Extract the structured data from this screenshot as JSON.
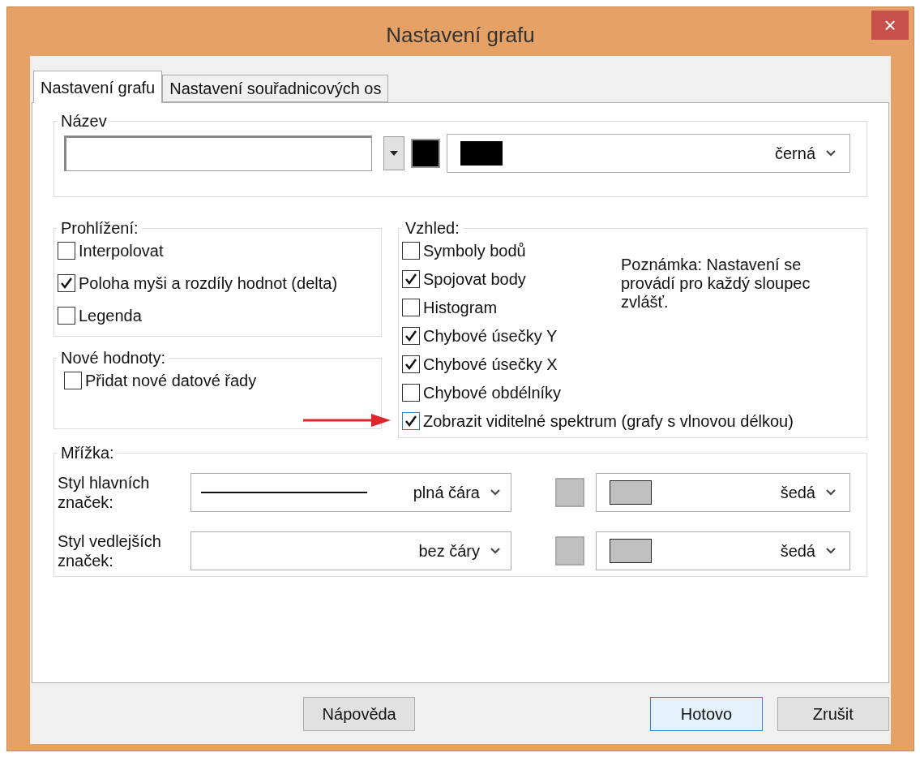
{
  "window": {
    "title": "Nastavení grafu",
    "close": "×"
  },
  "tabs": [
    {
      "label": "Nastavení grafu",
      "selected": true
    },
    {
      "label": "Nastavení souřadnicových os",
      "selected": false
    }
  ],
  "name_group": {
    "legend": "Název",
    "color": {
      "text": "černá",
      "color": "#000000"
    }
  },
  "view_group": {
    "legend": "Prohlížení:",
    "options": [
      {
        "label": "Interpolovat",
        "checked": false
      },
      {
        "label": "Poloha myši a rozdíly hodnot (delta)",
        "checked": true
      },
      {
        "label": "Legenda",
        "checked": false
      }
    ]
  },
  "new_values_group": {
    "legend": "Nové hodnoty:",
    "options": [
      {
        "label": "Přidat nové datové řady",
        "checked": false
      }
    ]
  },
  "appearance_group": {
    "legend": "Vzhled:",
    "note": "Poznámka: Nastavení se provádí pro každý sloupec zvlášť.",
    "options": [
      {
        "label": "Symboly bodů",
        "checked": false
      },
      {
        "label": "Spojovat body",
        "checked": true
      },
      {
        "label": "Histogram",
        "checked": false
      },
      {
        "label": "Chybové úsečky Y",
        "checked": true
      },
      {
        "label": "Chybové úsečky X",
        "checked": true
      },
      {
        "label": "Chybové obdélníky",
        "checked": false
      },
      {
        "label": "Zobrazit viditelné spektrum (grafy s vlnovou délkou)",
        "checked": true,
        "arrow": true
      }
    ]
  },
  "grid_group": {
    "legend": "Mřížka:",
    "rows": [
      {
        "label": "Styl hlavních značek:",
        "line_style": {
          "kind": "solid",
          "text": "plná čára"
        },
        "color": {
          "text": "šedá",
          "color": "#c0c0c0"
        }
      },
      {
        "label": "Styl vedlejších značek:",
        "line_style": {
          "kind": "none",
          "text": "bez čáry"
        },
        "color": {
          "text": "šedá",
          "color": "#c0c0c0"
        }
      }
    ]
  },
  "buttons": [
    {
      "label": "Nápověda",
      "default": false
    },
    {
      "label": "Hotovo",
      "default": true
    },
    {
      "label": "Zrušit",
      "default": false
    }
  ]
}
